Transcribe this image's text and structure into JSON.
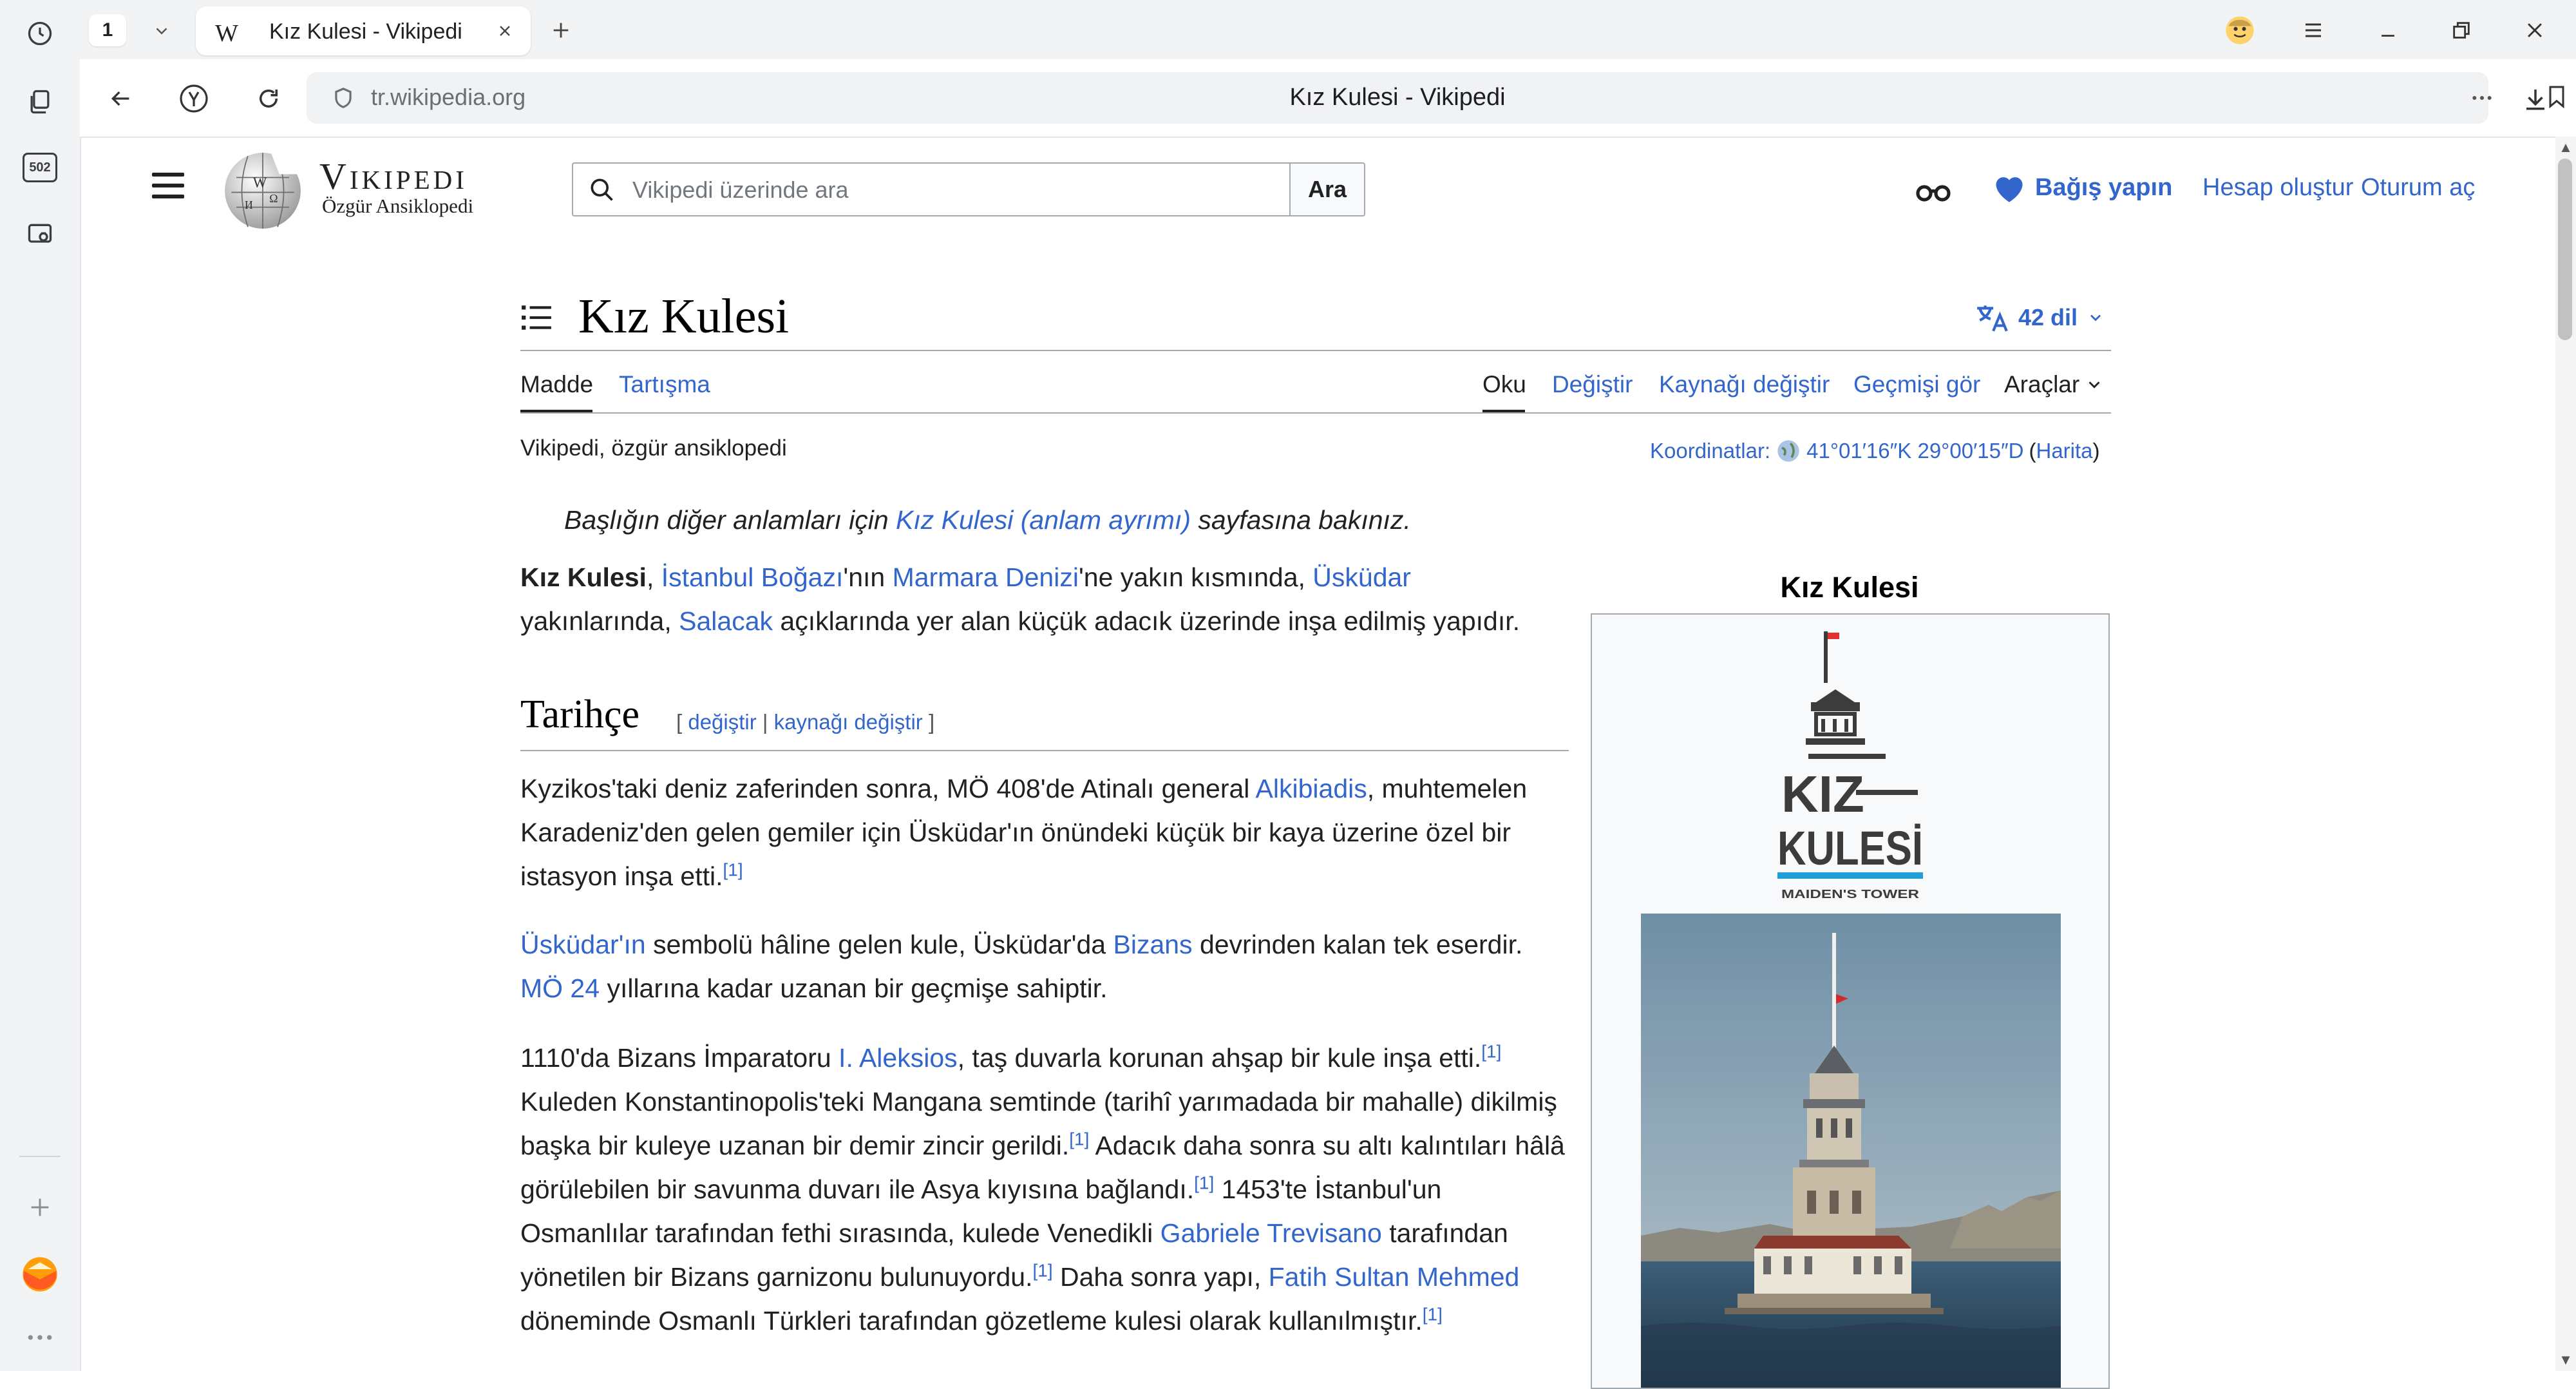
{
  "browser": {
    "tab_counter": "1",
    "tab_favicon": "W",
    "tab_title": "Kız Kulesi - Vikipedi",
    "rail_badge": "502",
    "address_url": "tr.wikipedia.org",
    "address_title": "Kız Kulesi - Vikipedi",
    "icons": [
      "history-icon",
      "collections-icon",
      "badge-icon",
      "screenshot-icon",
      "add-icon",
      "mail-icon",
      "more-icon",
      "back-icon",
      "yandex-icon",
      "reload-icon",
      "shield-icon",
      "menu-icon",
      "minimize-icon",
      "restore-icon",
      "close-icon",
      "download-icon",
      "bookmark-icon"
    ]
  },
  "wiki_header": {
    "wordmark": "Vikipedi",
    "tagline": "Özgür Ansiklopedi",
    "search_placeholder": "Vikipedi üzerinde ara",
    "search_button": "Ara",
    "donate": "Bağış yapın",
    "create_account": "Hesap oluştur",
    "login": "Oturum aç"
  },
  "article": {
    "title": "Kız Kulesi",
    "languages": "42 dil",
    "tabs_left": [
      "Madde",
      "Tartışma"
    ],
    "tabs_right": [
      "Oku",
      "Değiştir",
      "Kaynağı değiştir",
      "Geçmişi gör",
      "Araçlar"
    ],
    "site_sub": "Vikipedi, özgür ansiklopedi",
    "coords_label": "Koordinatlar:",
    "coords_value": "41°01′16″K 29°00′15″D",
    "coords_open": "(",
    "coords_map": "Harita",
    "coords_close": ")",
    "hatnote_before": "Başlığın diğer anlamları için ",
    "hatnote_link": "Kız Kulesi (anlam ayrımı)",
    "hatnote_after": " sayfasına bakınız.",
    "section_title": "Tarihçe",
    "section_edit_open": "[ ",
    "section_edit_1": "değiştir",
    "section_edit_sep": " | ",
    "section_edit_2": "kaynağı değiştir",
    "section_edit_close": " ]"
  },
  "intro": {
    "bold": "Kız Kulesi",
    "t1": ", ",
    "l1": "İstanbul Boğazı",
    "t2": "'nın ",
    "l2": "Marmara Denizi",
    "t3": "'ne yakın kısmında, ",
    "l3": "Üsküdar",
    "t4": " yakınlarında, ",
    "l4": "Salacak",
    "t5": " açıklarında yer alan küçük adacık üzerinde inşa edilmiş yapıdır."
  },
  "p1": {
    "t1": "Kyzikos'taki deniz zaferinden sonra, MÖ 408'de Atinalı general ",
    "l1": "Alkibiadis",
    "t2": ", muhtemelen Karadeniz'den gelen gemiler için Üsküdar'ın önündeki küçük bir kaya üzerine özel bir istasyon inşa etti.",
    "ref": "[1]"
  },
  "p2": {
    "l1": "Üsküdar'ın",
    "t1": " sembolü hâline gelen kule, Üsküdar'da ",
    "l2": "Bizans",
    "t2": " devrinden kalan tek eserdir. ",
    "l3": "MÖ 24",
    "t3": " yıllarına kadar uzanan bir geçmişe sahiptir."
  },
  "p3": {
    "t1": "1110'da Bizans İmparatoru ",
    "l1": "I. Aleksios",
    "t2": ", taş duvarla korunan ahşap bir kule inşa etti.",
    "r1": "[1]",
    "t3": " Kuleden Konstantinopolis'teki Mangana semtinde (tarihî yarımadada bir mahalle) dikilmiş başka bir kuleye uzanan bir demir zincir gerildi.",
    "r2": "[1]",
    "t4": " Adacık daha sonra su altı kalıntıları hâlâ görülebilen bir savunma duvarı ile Asya kıyısına bağlandı.",
    "r3": "[1]",
    "t5": " 1453'te İstanbul'un Osmanlılar tarafından fethi sırasında, kulede Venedikli ",
    "l2": "Gabriele Trevisano",
    "t6": " tarafından yönetilen bir Bizans garnizonu bulunuyordu.",
    "r4": "[1]",
    "t7": " Daha sonra yapı, ",
    "l3": "Fatih Sultan Mehmed",
    "t8": " döneminde Osmanlı Türkleri tarafından gözetleme kulesi olarak kullanılmıştır.",
    "r5": "[1]"
  },
  "infobox": {
    "caption": "Kız Kulesi",
    "logo_line1": "KIZ",
    "logo_line2": "KULESİ",
    "logo_sub": "MAIDEN'S TOWER"
  },
  "colors": {
    "link": "#3366cc",
    "text": "#202122",
    "rail": "#f2f3f5",
    "donate_heart": "#3366cc"
  }
}
